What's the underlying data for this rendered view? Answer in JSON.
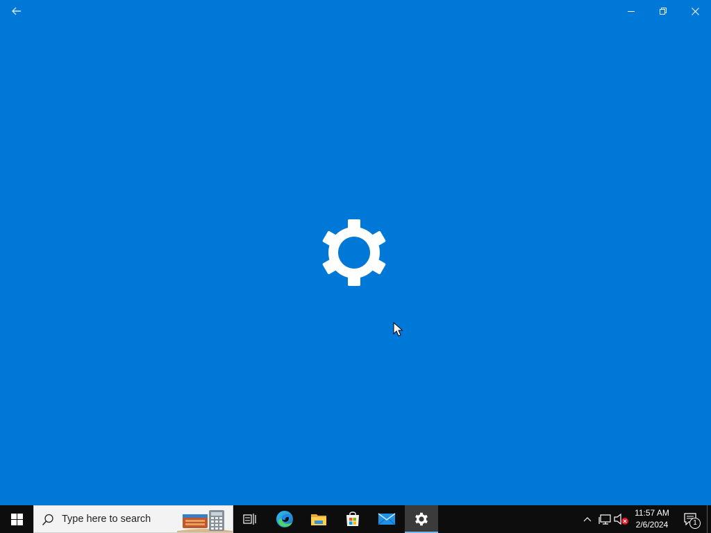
{
  "window": {
    "title_bar": {
      "back_icon": "arrow-left-icon",
      "minimize_icon": "minimize-icon",
      "restore_icon": "restore-icon",
      "close_icon": "close-icon"
    },
    "splash_icon": "gear-icon",
    "background_color": "#0078d7"
  },
  "taskbar": {
    "background_color": "#0d0d0d",
    "start_icon": "windows-logo-icon",
    "search": {
      "placeholder": "Type here to search",
      "icon": "search-icon"
    },
    "pinned": [
      {
        "name": "task-view",
        "icon": "task-view-icon",
        "active": false
      },
      {
        "name": "edge",
        "icon": "edge-icon",
        "active": false
      },
      {
        "name": "file-explorer",
        "icon": "folder-icon",
        "active": false
      },
      {
        "name": "store",
        "icon": "store-icon",
        "active": false
      },
      {
        "name": "mail",
        "icon": "mail-icon",
        "active": false
      },
      {
        "name": "settings",
        "icon": "gear-icon",
        "active": true
      }
    ],
    "tray": {
      "icons": [
        "chevron-up-icon",
        "network-icon",
        "volume-muted-icon"
      ],
      "time": "11:57 AM",
      "date": "2/6/2024",
      "notification_count": "1"
    }
  }
}
